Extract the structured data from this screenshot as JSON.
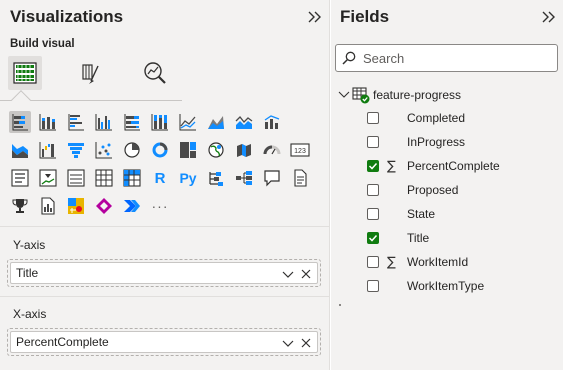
{
  "visualizations": {
    "title": "Visualizations",
    "build_visual_label": "Build visual",
    "tabs": [
      {
        "name": "build-visual",
        "icon": "table-grid-icon",
        "selected": true
      },
      {
        "name": "format-visual",
        "icon": "paintbrush-icon",
        "selected": false
      },
      {
        "name": "analytics",
        "icon": "magnifier-chart-icon",
        "selected": false
      }
    ],
    "more_label": "···",
    "py_label": "Py",
    "r_label": "R",
    "number_label": "123",
    "y_axis": {
      "label": "Y-axis",
      "field": "Title"
    },
    "x_axis": {
      "label": "X-axis",
      "field": "PercentComplete"
    }
  },
  "fields": {
    "title": "Fields",
    "search_placeholder": "Search",
    "table": {
      "name": "feature-progress",
      "items": [
        {
          "label": "Completed",
          "checked": false,
          "sigma": false
        },
        {
          "label": "InProgress",
          "checked": false,
          "sigma": false
        },
        {
          "label": "PercentComplete",
          "checked": true,
          "sigma": true
        },
        {
          "label": "Proposed",
          "checked": false,
          "sigma": false
        },
        {
          "label": "State",
          "checked": false,
          "sigma": false
        },
        {
          "label": "Title",
          "checked": true,
          "sigma": false
        },
        {
          "label": "WorkItemId",
          "checked": false,
          "sigma": true
        },
        {
          "label": "WorkItemType",
          "checked": false,
          "sigma": false
        }
      ]
    }
  },
  "colors": {
    "accent_green": "#107c10",
    "teal": "#118dff",
    "yellow": "#e8b500",
    "dark_chart": "#4a4a4a"
  }
}
